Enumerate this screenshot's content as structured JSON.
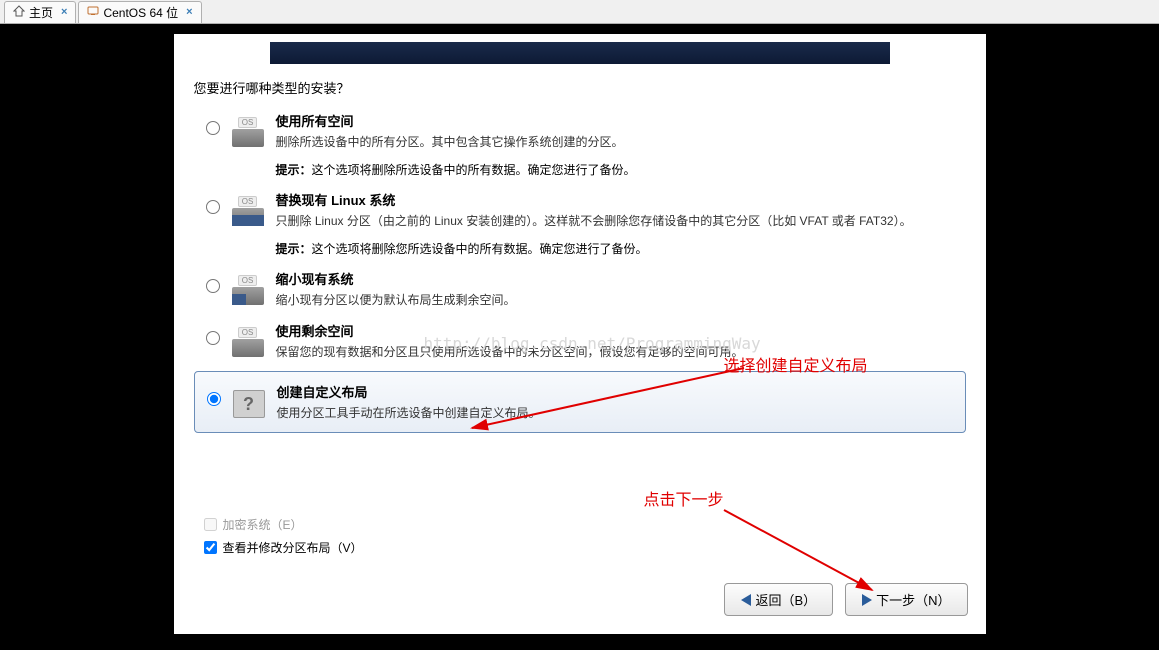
{
  "tabs": {
    "home": "主页",
    "vm": "CentOS 64 位"
  },
  "installer": {
    "prompt": "您要进行哪种类型的安装？",
    "options": [
      {
        "title": "使用所有空间",
        "desc": "删除所选设备中的所有分区。其中包含其它操作系统创建的分区。",
        "tip_label": "提示：",
        "tip": "这个选项将删除所选设备中的所有数据。确定您进行了备份。"
      },
      {
        "title": "替换现有 Linux 系统",
        "desc": "只删除 Linux 分区（由之前的 Linux 安装创建的）。这样就不会删除您存储设备中的其它分区（比如 VFAT 或者 FAT32）。",
        "tip_label": "提示：",
        "tip": "这个选项将删除您所选设备中的所有数据。确定您进行了备份。"
      },
      {
        "title": "缩小现有系统",
        "desc": "缩小现有分区以便为默认布局生成剩余空间。"
      },
      {
        "title": "使用剩余空间",
        "desc": "保留您的现有数据和分区且只使用所选设备中的未分区空间，假设您有足够的空间可用。"
      },
      {
        "title": "创建自定义布局",
        "desc": "使用分区工具手动在所选设备中创建自定义布局。"
      }
    ],
    "checkbox_encrypt": "加密系统（E）",
    "checkbox_review": "查看并修改分区布局（V）",
    "button_back": "返回（B）",
    "button_next": "下一步（N）"
  },
  "annotations": {
    "select_custom": "选择创建自定义布局",
    "click_next": "点击下一步"
  },
  "watermark": "http://blog.csdn.net/ProgrammingWay"
}
